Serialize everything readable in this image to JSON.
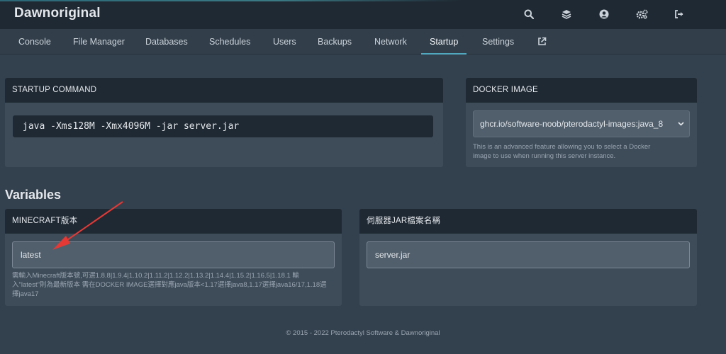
{
  "brand": "Dawnoriginal",
  "top_icons": [
    "search-icon",
    "layers-icon",
    "user-circle-icon",
    "cogs-icon",
    "sign-out-icon"
  ],
  "nav": {
    "tabs": [
      "Console",
      "File Manager",
      "Databases",
      "Schedules",
      "Users",
      "Backups",
      "Network",
      "Startup",
      "Settings"
    ],
    "active": "Startup",
    "external_icon": "external-link-icon"
  },
  "startup": {
    "header": "STARTUP COMMAND",
    "command": "java -Xms128M -Xmx4096M -jar server.jar"
  },
  "docker": {
    "header": "DOCKER IMAGE",
    "selected": "ghcr.io/software-noob/pterodactyl-images:java_8",
    "help_line1": "This is an advanced feature allowing you to select a Docker",
    "help_line2": "image to use when running this server instance."
  },
  "variables_title": "Variables",
  "variables": [
    {
      "header": "MINECRAFT版本",
      "value": "latest",
      "desc_line1": "需輸入Minecraft版本號,可選1.8.8|1.9.4|1.10.2|1.11.2|1.12.2|1.13.2|1.14.4|1.15.2|1.16.5|1.18.1 輸",
      "desc_line2": "入\"latest\"則為最新版本 需在DOCKER IMAGE選擇對應java版本<1.17選擇java8,1.17選擇java16/17,1.18選",
      "desc_line3": "擇java17"
    },
    {
      "header": "伺服器JAR檔案名稱",
      "value": "server.jar"
    }
  ],
  "footer": "© 2015 - 2022 Pterodactyl Software & Dawnoriginal",
  "colors": {
    "topbar": "#1f2933",
    "background": "#33404d",
    "panel": "#3e4c59",
    "accent": "#4fa8bd",
    "annotation_arrow": "#e53935"
  }
}
